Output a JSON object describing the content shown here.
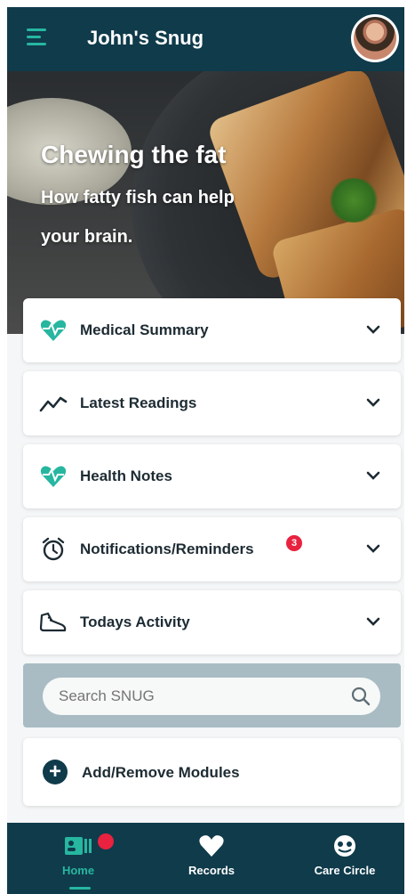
{
  "header": {
    "title": "John's Snug",
    "menu_icon": "hamburger-menu-icon",
    "avatar": "user-avatar"
  },
  "hero": {
    "title": "Chewing the fat",
    "subtitle": "How fatty fish can help your brain."
  },
  "modules": [
    {
      "label": "Medical Summary",
      "icon": "heart-pulse-icon"
    },
    {
      "label": "Latest Readings",
      "icon": "trend-line-icon"
    },
    {
      "label": "Health Notes",
      "icon": "heart-pulse-icon"
    },
    {
      "label": "Notifications/Reminders",
      "icon": "alarm-clock-icon",
      "badge": "3"
    },
    {
      "label": "Todays Activity",
      "icon": "shoe-icon"
    }
  ],
  "search": {
    "placeholder": "Search SNUG"
  },
  "add_modules": {
    "label": "Add/Remove Modules"
  },
  "bottom_nav": [
    {
      "label": "Home",
      "icon": "home-id-icon",
      "active": true
    },
    {
      "label": "Records",
      "icon": "heart-icon"
    },
    {
      "label": "Care Circle",
      "icon": "care-circle-icon"
    }
  ],
  "colors": {
    "brand_dark": "#0f3b4b",
    "accent_teal": "#27b6a0",
    "alert_red": "#e8223f"
  }
}
